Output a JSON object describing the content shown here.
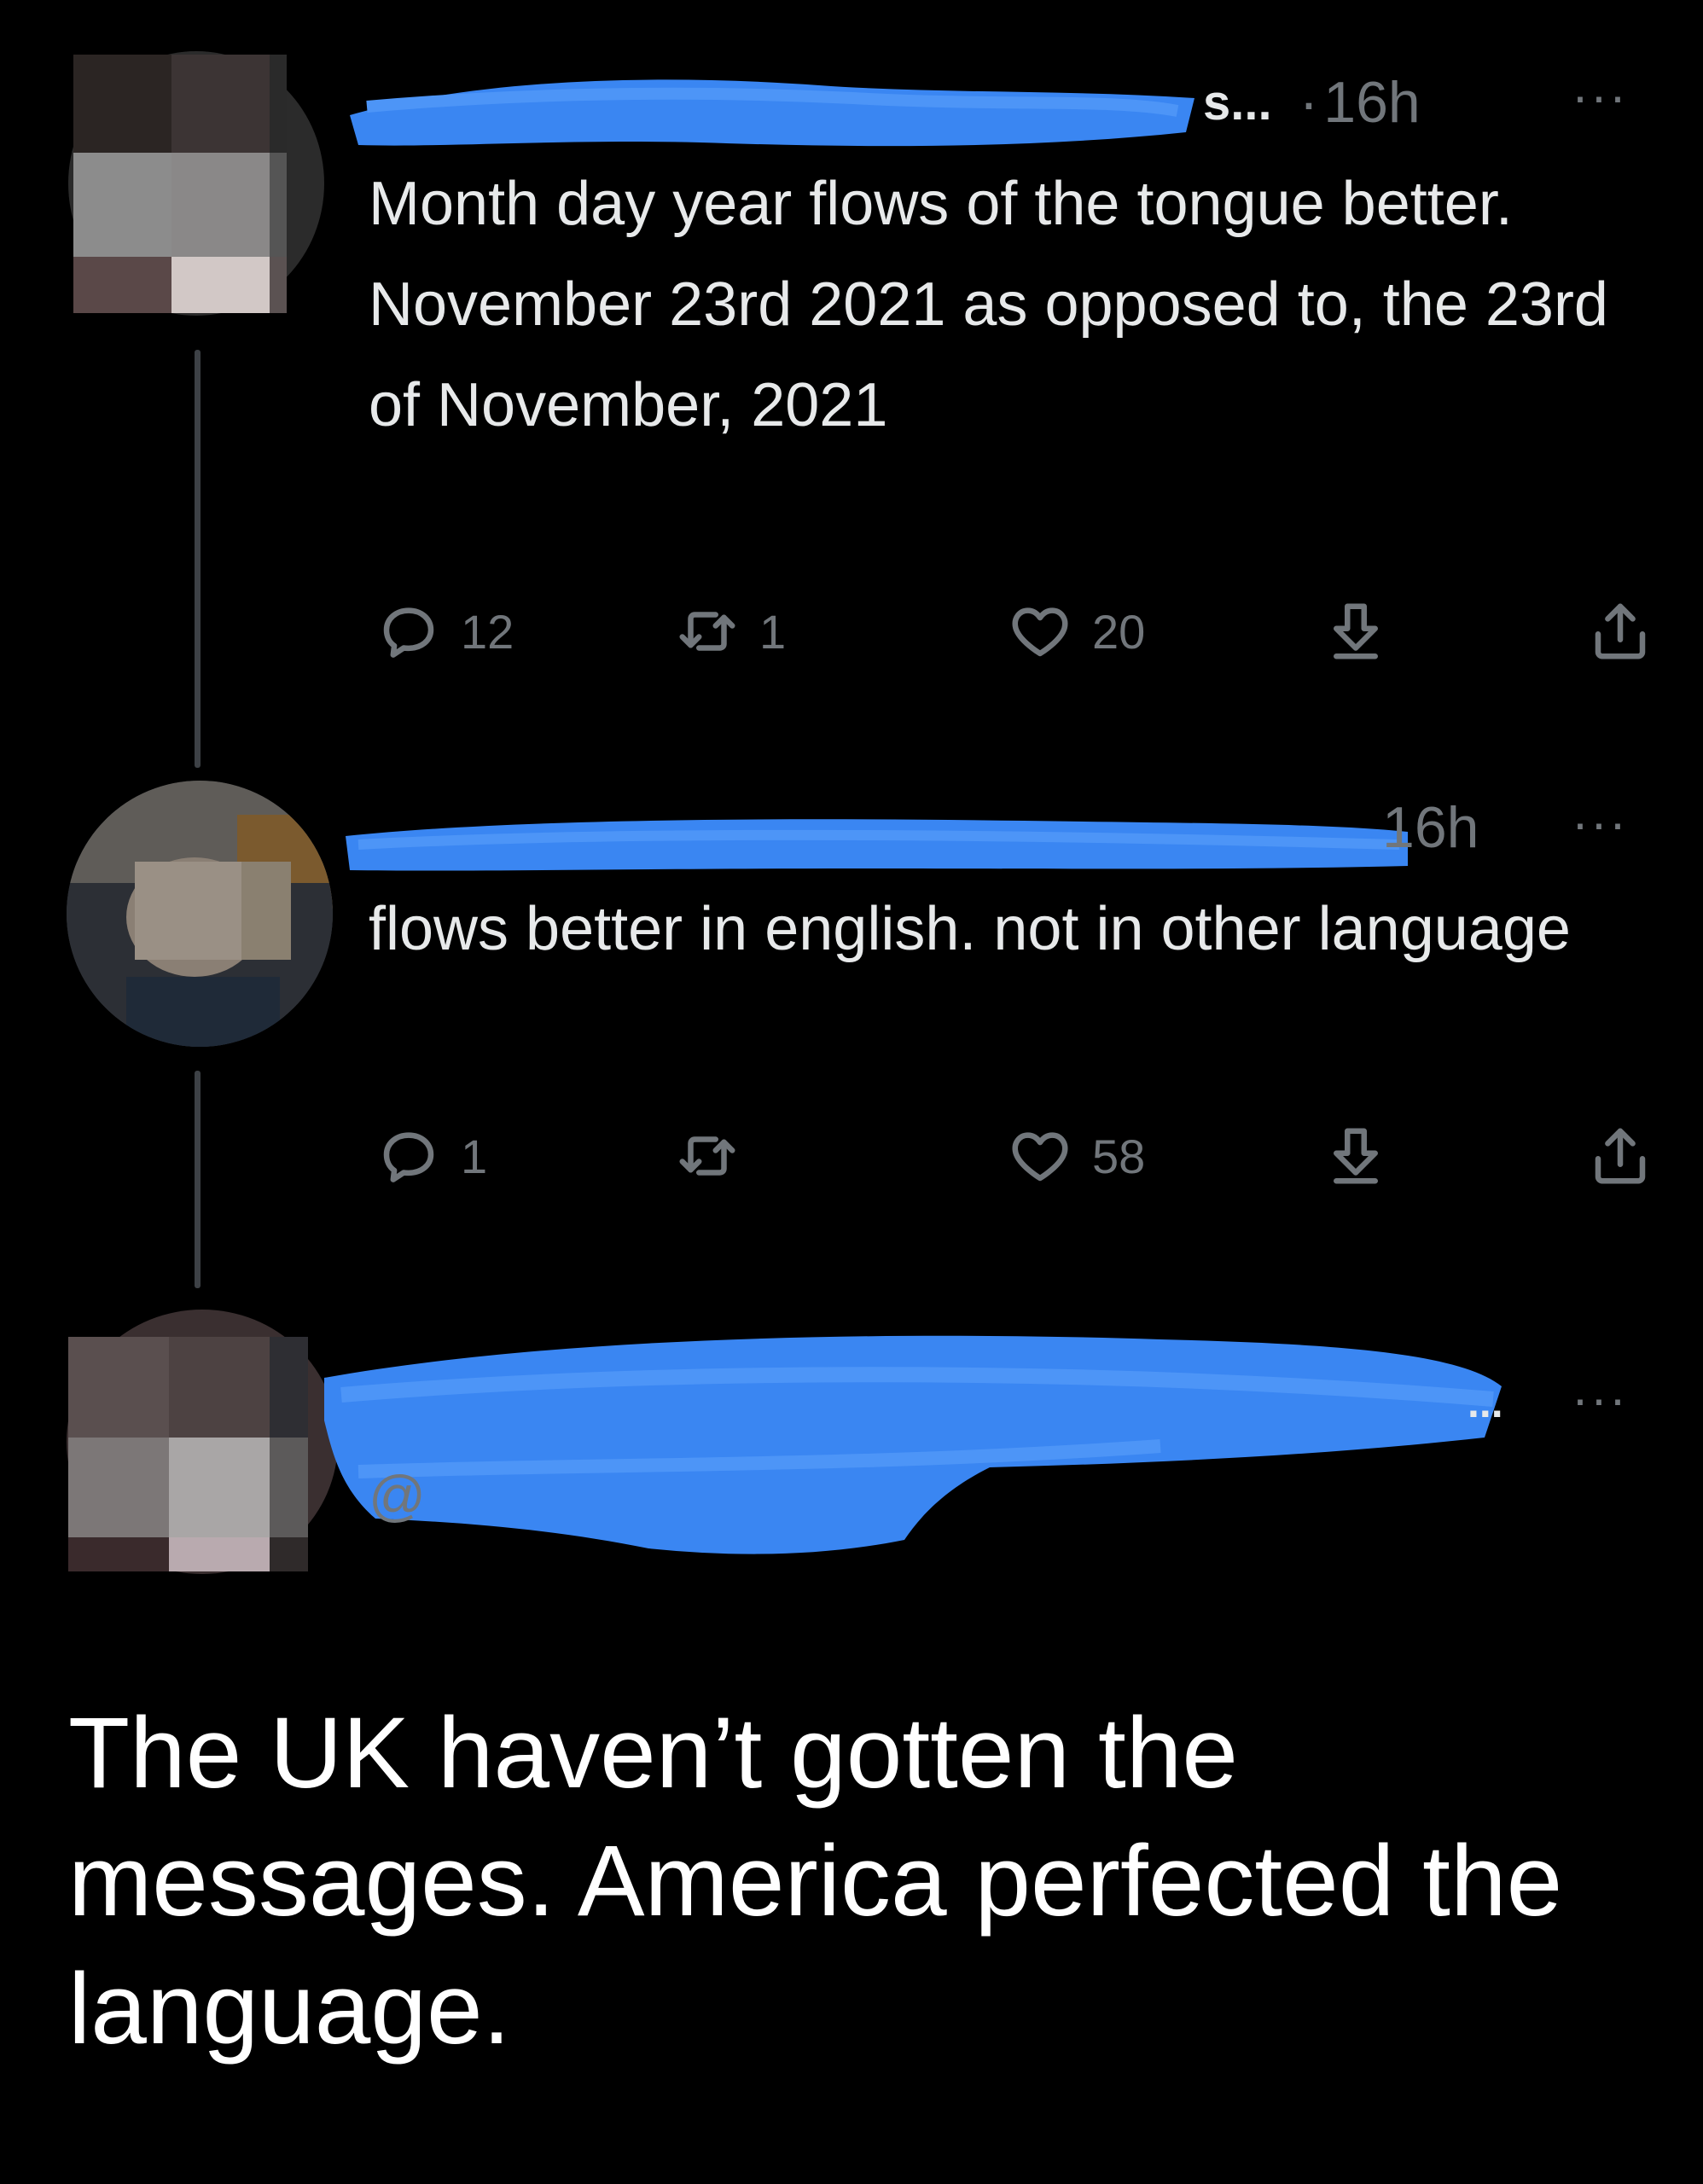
{
  "tweets": [
    {
      "name_fragment": "s...",
      "dot": "·",
      "time": "16h",
      "more": "···",
      "text": "Month day year flows of the tongue better. November 23rd 2021 as opposed to, the 23rd of November, 2021",
      "replies": "12",
      "retweets": "1",
      "likes": "20"
    },
    {
      "time": "16h",
      "more": "···",
      "text": "flows better in english. not in other language",
      "replies": "1",
      "retweets": "",
      "likes": "58"
    }
  ],
  "quoted_account": {
    "name_fragment": "...",
    "handle_fragment": "@",
    "more": "···"
  },
  "reply": {
    "text": "The UK haven’t gotten the messages. America perfected the language."
  },
  "icons": [
    "comment-icon",
    "retweet-icon",
    "heart-icon",
    "download-icon",
    "share-icon"
  ],
  "colors": {
    "background": "#000000",
    "text": "#e7e9ea",
    "muted": "#71767b",
    "redaction": "#3b82f6"
  }
}
